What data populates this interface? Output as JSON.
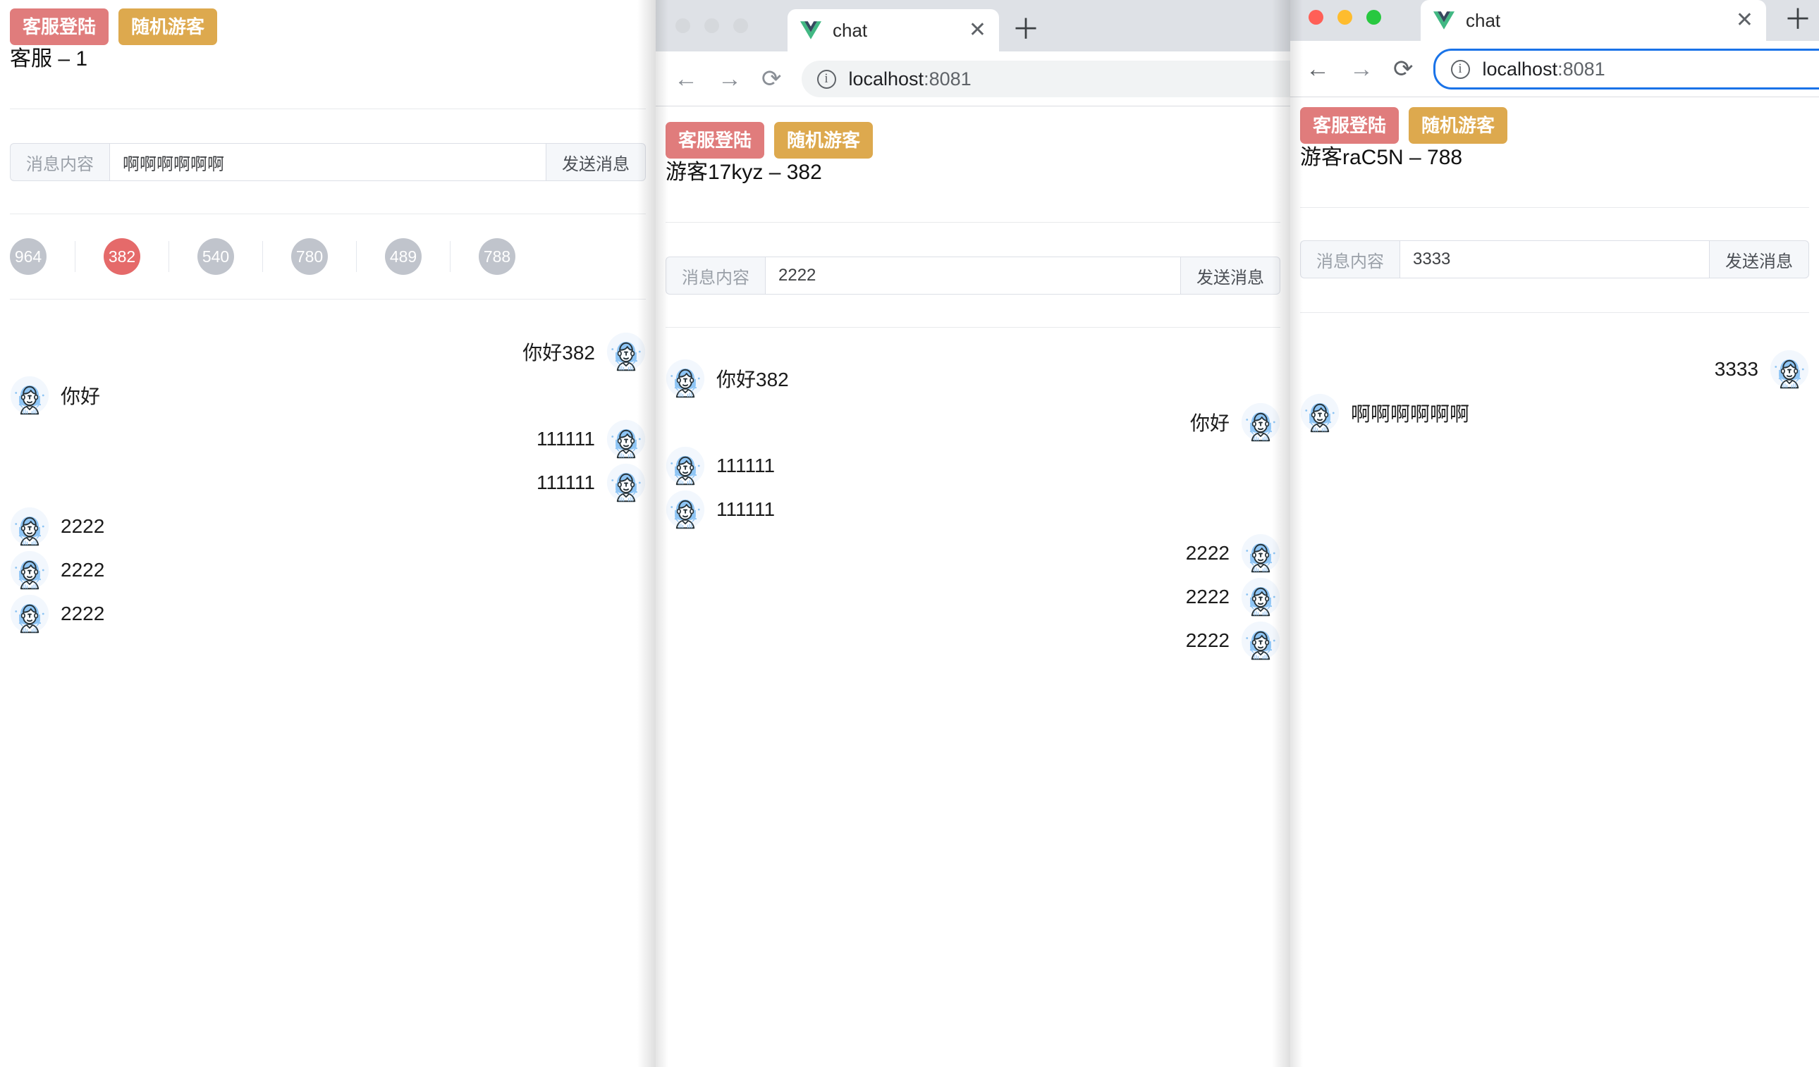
{
  "common": {
    "btn_login_label": "客服登陆",
    "btn_guest_label": "随机游客",
    "msg_prepend_label": "消息内容",
    "send_label": "发送消息",
    "colors": {
      "danger": "#e07c7c",
      "warn": "#dda94e",
      "active_circle": "#e56a6a",
      "idle_circle": "#c0c4cc"
    }
  },
  "panel_left": {
    "user_line": "客服 – 1",
    "input_value": "啊啊啊啊啊啊",
    "circles": [
      {
        "id": "964",
        "active": false
      },
      {
        "id": "382",
        "active": true
      },
      {
        "id": "540",
        "active": false
      },
      {
        "id": "780",
        "active": false
      },
      {
        "id": "489",
        "active": false
      },
      {
        "id": "788",
        "active": false
      }
    ],
    "messages": [
      {
        "text": "你好382",
        "side": "right"
      },
      {
        "text": "你好",
        "side": "left"
      },
      {
        "text": "111111",
        "side": "right"
      },
      {
        "text": "111111",
        "side": "right"
      },
      {
        "text": "2222",
        "side": "left"
      },
      {
        "text": "2222",
        "side": "left"
      },
      {
        "text": "2222",
        "side": "left"
      }
    ]
  },
  "panel_mid": {
    "browser": {
      "tab_title": "chat",
      "tab_close_glyph": "✕",
      "newtab_glyph": "＋",
      "back_glyph": "←",
      "forward_glyph": "→",
      "reload_glyph": "⟳",
      "info_glyph": "i",
      "url_host": "localhost",
      "url_port": ":8081"
    },
    "user_line": "游客17kyz – 382",
    "input_value": "2222",
    "messages": [
      {
        "text": "你好382",
        "side": "left"
      },
      {
        "text": "你好",
        "side": "right"
      },
      {
        "text": "111111",
        "side": "left"
      },
      {
        "text": "111111",
        "side": "left"
      },
      {
        "text": "2222",
        "side": "right"
      },
      {
        "text": "2222",
        "side": "right"
      },
      {
        "text": "2222",
        "side": "right"
      }
    ]
  },
  "panel_right": {
    "browser": {
      "tab_title": "chat",
      "tab_close_glyph": "✕",
      "newtab_glyph": "＋",
      "back_glyph": "←",
      "forward_glyph": "→",
      "reload_glyph": "⟳",
      "info_glyph": "i",
      "url_host": "localhost",
      "url_port": ":8081"
    },
    "user_line": "游客raC5N – 788",
    "input_value": "3333",
    "messages": [
      {
        "text": "3333",
        "side": "right"
      },
      {
        "text": "啊啊啊啊啊啊",
        "side": "left"
      }
    ]
  }
}
